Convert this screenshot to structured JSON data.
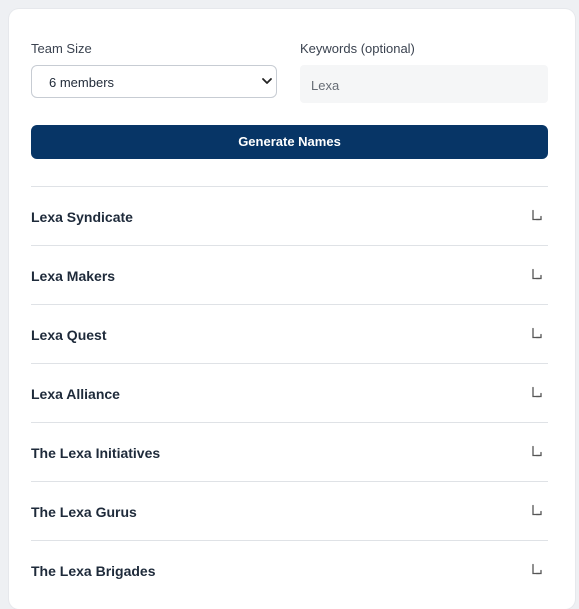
{
  "form": {
    "team_size_label": "Team Size",
    "team_size_value": "6 members",
    "keywords_label": "Keywords (optional)",
    "keywords_value": "Lexa"
  },
  "generate_button_label": "Generate Names",
  "results": [
    {
      "name": "Lexa Syndicate",
      "icon": "copy-icon"
    },
    {
      "name": "Lexa Makers",
      "icon": "copy-icon"
    },
    {
      "name": "Lexa Quest",
      "icon": "copy-icon"
    },
    {
      "name": "Lexa Alliance",
      "icon": "copy-icon"
    },
    {
      "name": "The Lexa Initiatives",
      "icon": "copy-icon"
    },
    {
      "name": "The Lexa Gurus",
      "icon": "copy-icon"
    },
    {
      "name": "The Lexa Brigades",
      "icon": "copy-icon"
    }
  ],
  "colors": {
    "accent": "#073566",
    "background": "#eef0f3"
  }
}
